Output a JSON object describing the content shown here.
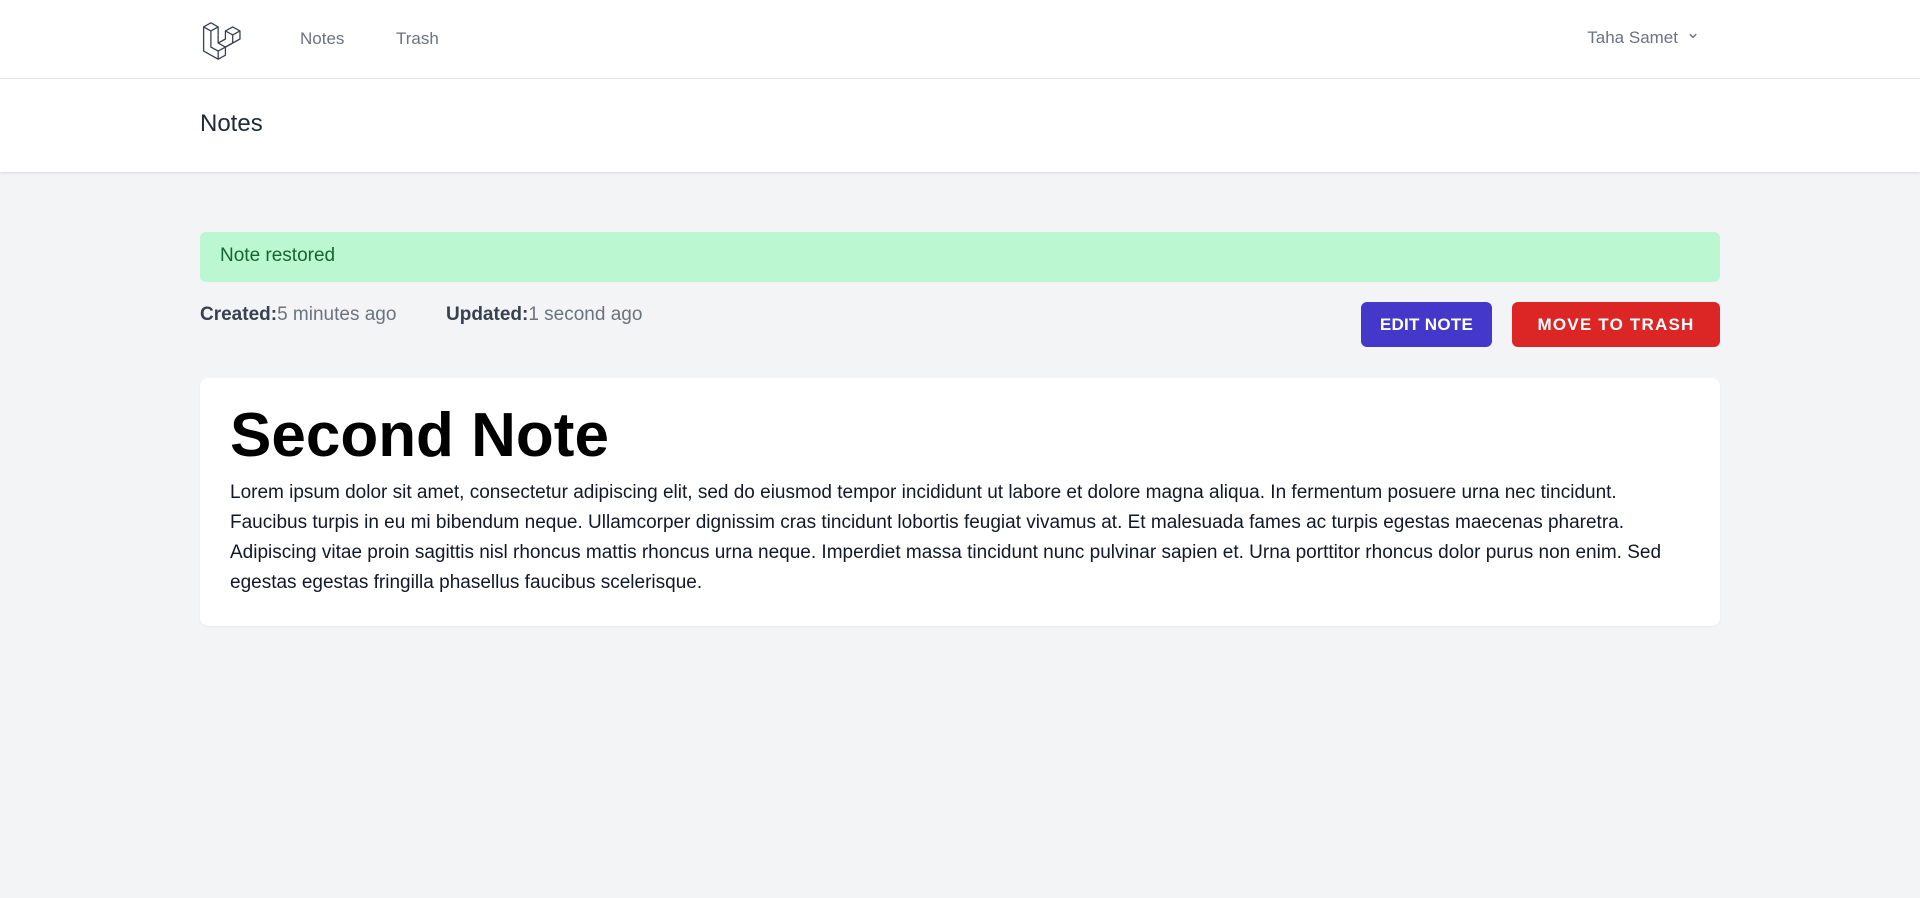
{
  "nav": {
    "logo_icon": "laravel-logo-icon",
    "links": [
      {
        "label": "Notes"
      },
      {
        "label": "Trash"
      }
    ],
    "user": {
      "name": "Taha Samet",
      "icon": "chevron-down-icon"
    }
  },
  "header": {
    "title": "Notes"
  },
  "flash": {
    "message": "Note restored",
    "color": "#bbf7d0"
  },
  "meta": {
    "created_label": "Created:",
    "created_value": "5 minutes ago",
    "updated_label": "Updated:",
    "updated_value": "1 second ago"
  },
  "actions": {
    "edit_label": "EDIT NOTE",
    "edit_color": "#4338ca",
    "trash_label": "MOVE TO TRASH",
    "trash_color": "#dc2626"
  },
  "note": {
    "title": "Second Note",
    "body": "Lorem ipsum dolor sit amet, consectetur adipiscing elit, sed do eiusmod tempor incididunt ut labore et dolore magna aliqua. In fermentum posuere urna nec tincidunt. Faucibus turpis in eu mi bibendum neque. Ullamcorper dignissim cras tincidunt lobortis feugiat vivamus at. Et malesuada fames ac turpis egestas maecenas pharetra. Adipiscing vitae proin sagittis nisl rhoncus mattis rhoncus urna neque. Imperdiet massa tincidunt nunc pulvinar sapien et. Urna porttitor rhoncus dolor purus non enim. Sed egestas egestas fringilla phasellus faucibus scelerisque."
  }
}
